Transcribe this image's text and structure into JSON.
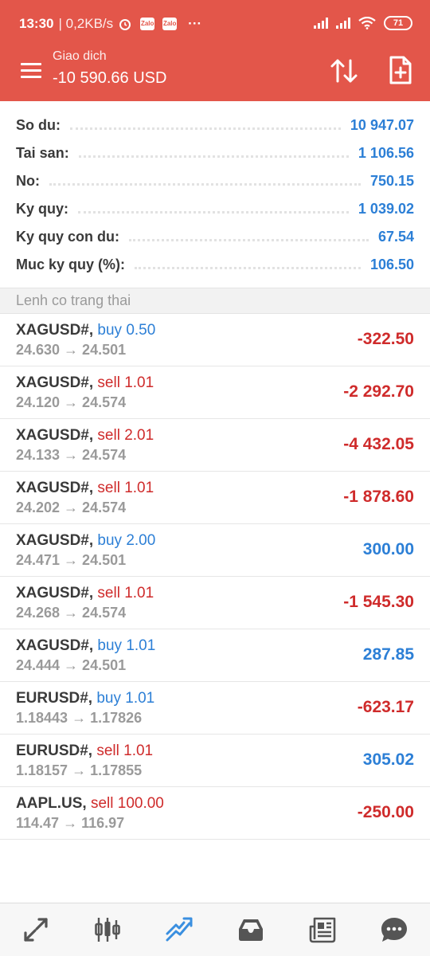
{
  "status_bar": {
    "time": "13:30",
    "speed": "| 0,2KB/s",
    "app_badge_1": "Zalo",
    "app_badge_2": "Zalo",
    "more": "···",
    "battery": "71"
  },
  "header": {
    "title": "Giao dich",
    "profit": "-10 590.66 USD"
  },
  "summary": [
    {
      "label": "So du:",
      "value": "10 947.07"
    },
    {
      "label": "Tai san:",
      "value": "1 106.56"
    },
    {
      "label": "No:",
      "value": "750.15"
    },
    {
      "label": "Ky quy:",
      "value": "1 039.02"
    },
    {
      "label": "Ky quy con du:",
      "value": "67.54"
    },
    {
      "label": "Muc ky quy (%):",
      "value": "106.50"
    }
  ],
  "section_title": "Lenh co trang thai",
  "positions": [
    {
      "symbol": "XAGUSD#,",
      "dir": "buy 0.50",
      "prices": "24.630 → 24.501",
      "profit": "-322.50"
    },
    {
      "symbol": "XAGUSD#,",
      "dir": "sell 1.01",
      "prices": "24.120 → 24.574",
      "profit": "-2 292.70"
    },
    {
      "symbol": "XAGUSD#,",
      "dir": "sell 2.01",
      "prices": "24.133 → 24.574",
      "profit": "-4 432.05"
    },
    {
      "symbol": "XAGUSD#,",
      "dir": "sell 1.01",
      "prices": "24.202 → 24.574",
      "profit": "-1 878.60"
    },
    {
      "symbol": "XAGUSD#,",
      "dir": "buy 2.00",
      "prices": "24.471 → 24.501",
      "profit": "300.00"
    },
    {
      "symbol": "XAGUSD#,",
      "dir": "sell 1.01",
      "prices": "24.268 → 24.574",
      "profit": "-1 545.30"
    },
    {
      "symbol": "XAGUSD#,",
      "dir": "buy 1.01",
      "prices": "24.444 → 24.501",
      "profit": "287.85"
    },
    {
      "symbol": "EURUSD#,",
      "dir": "buy 1.01",
      "prices": "1.18443 → 1.17826",
      "profit": "-623.17"
    },
    {
      "symbol": "EURUSD#,",
      "dir": "sell 1.01",
      "prices": "1.18157 → 1.17855",
      "profit": "305.02"
    },
    {
      "symbol": "AAPL.US,",
      "dir": "sell 100.00",
      "prices": "114.47 → 116.97",
      "profit": "-250.00"
    }
  ],
  "bottom_nav": [
    {
      "icon": "quotes-icon"
    },
    {
      "icon": "chart-icon"
    },
    {
      "icon": "trade-icon",
      "active": true
    },
    {
      "icon": "history-icon"
    },
    {
      "icon": "news-icon"
    },
    {
      "icon": "chat-icon"
    }
  ],
  "colors": {
    "header_bg": "#e3564a",
    "accent_blue": "#2c7fd6",
    "loss_red": "#cf2b2b"
  }
}
